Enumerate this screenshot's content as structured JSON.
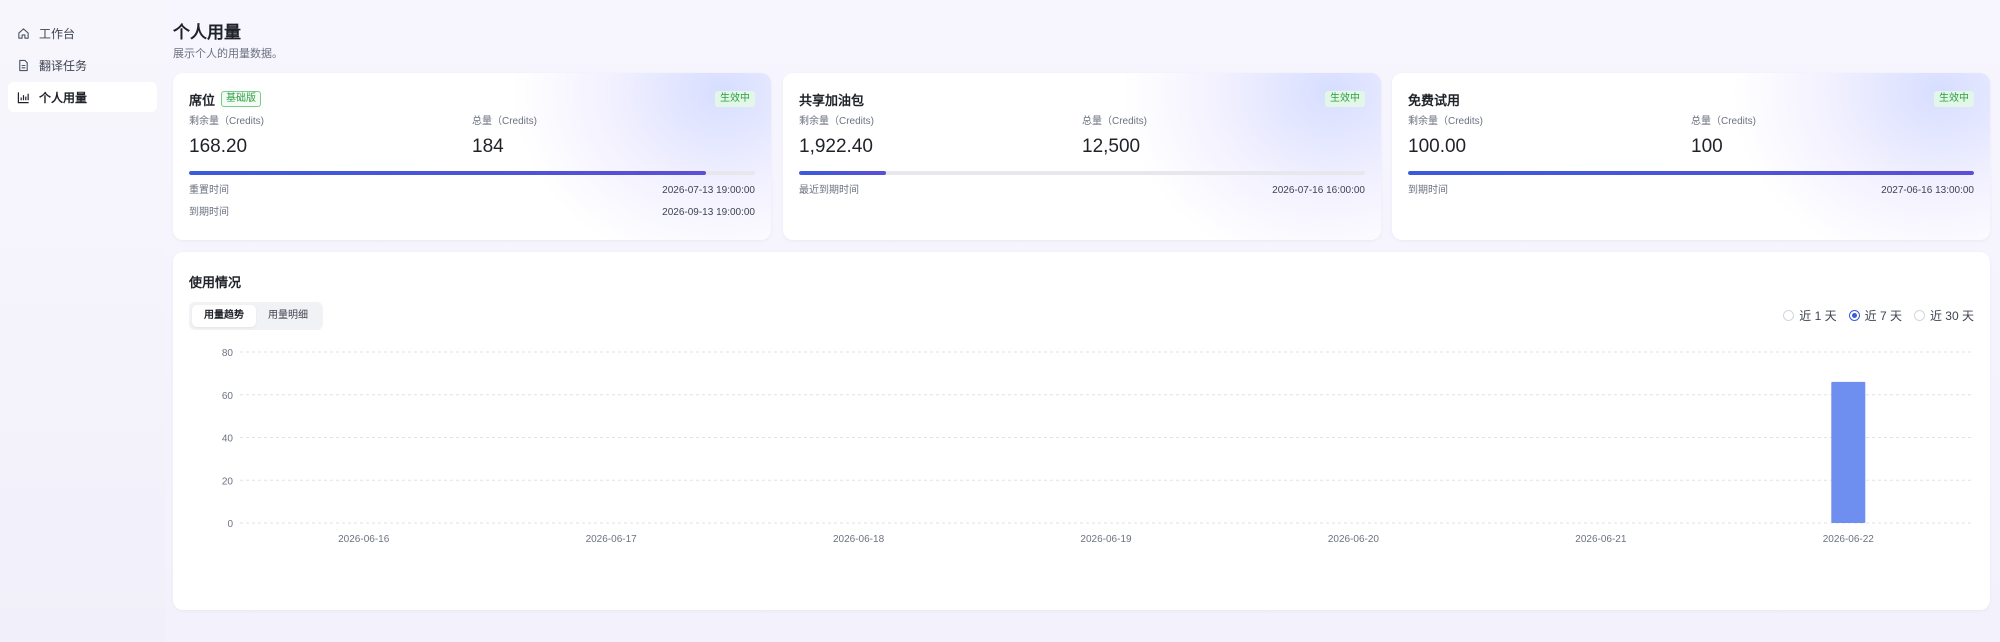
{
  "sidebar": {
    "items": [
      {
        "label": "工作台",
        "icon": "home-icon"
      },
      {
        "label": "翻译任务",
        "icon": "document-icon"
      },
      {
        "label": "个人用量",
        "icon": "bar-chart-icon",
        "active": true
      }
    ]
  },
  "header": {
    "title": "个人用量",
    "subtitle": "展示个人的用量数据。"
  },
  "cards": [
    {
      "title": "席位",
      "plan_tag": "基础版",
      "status": "生效中",
      "remaining_label": "剩余量（Credits)",
      "remaining_value": "168.20",
      "total_label": "总量（Credits)",
      "total_value": "184",
      "progress": 0.914,
      "rows": [
        {
          "label": "重置时间",
          "value": "2026-07-13 19:00:00"
        },
        {
          "label": "到期时间",
          "value": "2026-09-13 19:00:00"
        }
      ]
    },
    {
      "title": "共享加油包",
      "status": "生效中",
      "remaining_label": "剩余量（Credits)",
      "remaining_value": "1,922.40",
      "total_label": "总量（Credits)",
      "total_value": "12,500",
      "progress": 0.154,
      "rows": [
        {
          "label": "最近到期时间",
          "value": "2026-07-16 16:00:00"
        }
      ]
    },
    {
      "title": "免费试用",
      "status": "生效中",
      "remaining_label": "剩余量（Credits)",
      "remaining_value": "100.00",
      "total_label": "总量（Credits)",
      "total_value": "100",
      "progress": 1.0,
      "rows": [
        {
          "label": "到期时间",
          "value": "2027-06-16 13:00:00"
        }
      ]
    }
  ],
  "usage": {
    "title": "使用情况",
    "tabs": [
      "用量趋势",
      "用量明细"
    ],
    "active_tab": 0,
    "ranges": [
      "近 1 天",
      "近 7 天",
      "近 30 天"
    ],
    "active_range": 1
  },
  "colors": {
    "accent": "#3b5bdb",
    "bar": "#6f8ff0",
    "status_green": "#2f9e44"
  },
  "chart_data": {
    "type": "bar",
    "categories": [
      "2026-06-16",
      "2026-06-17",
      "2026-06-18",
      "2026-06-19",
      "2026-06-20",
      "2026-06-21",
      "2026-06-22"
    ],
    "values": [
      0,
      0,
      0,
      0,
      0,
      0,
      66
    ],
    "yticks": [
      0,
      20,
      40,
      60,
      80
    ],
    "ylim": [
      0,
      80
    ],
    "grid": true,
    "title": "",
    "xlabel": "",
    "ylabel": ""
  }
}
